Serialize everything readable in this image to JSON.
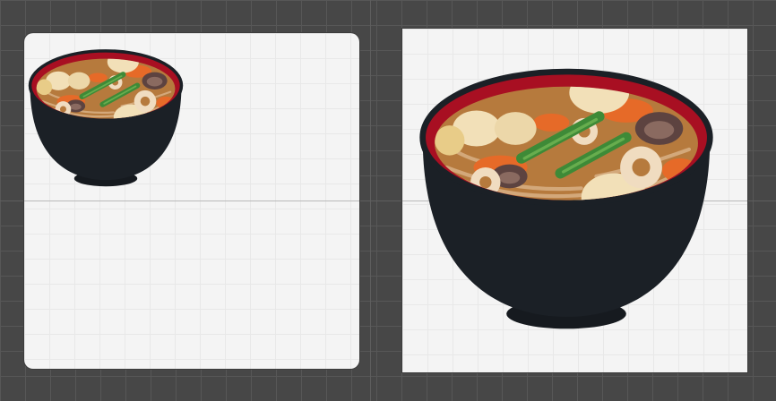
{
  "scene": {
    "background_color": "#474747",
    "grid_color": "#575757"
  },
  "sprites": [
    {
      "id": "rounded-preview",
      "icon": "noodle-soup-bowl-icon",
      "bowl_outer": "#1b2026",
      "bowl_rim": "#a80f22",
      "broth": "#b67a3d"
    },
    {
      "id": "square-preview",
      "icon": "noodle-soup-bowl-icon",
      "bowl_outer": "#1b2026",
      "bowl_rim": "#a80f22",
      "broth": "#b67a3d"
    }
  ]
}
